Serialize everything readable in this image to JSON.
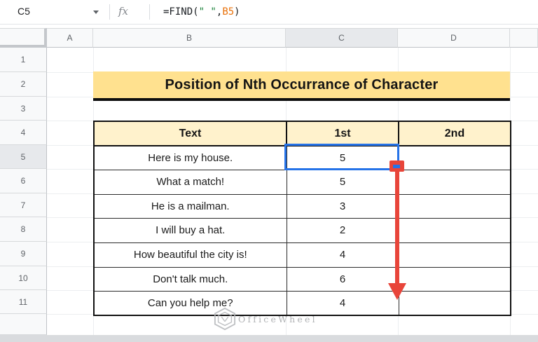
{
  "formula_bar": {
    "cell_reference": "C5",
    "fx_label": "fx",
    "formula_full": "=FIND(\" \",B5)",
    "formula_segments": [
      {
        "text": "=FIND(",
        "color": "#1b1f23"
      },
      {
        "text": "\" \"",
        "color": "#188038"
      },
      {
        "text": ",",
        "color": "#1b1f23"
      },
      {
        "text": "B5",
        "color": "#e8710a"
      },
      {
        "text": ")",
        "color": "#1b1f23"
      }
    ]
  },
  "grid": {
    "column_headers": [
      "A",
      "B",
      "C",
      "D",
      ""
    ],
    "row_headers": [
      "1",
      "2",
      "3",
      "4",
      "5",
      "6",
      "7",
      "8",
      "9",
      "10",
      "11",
      ""
    ],
    "selected_column": "C",
    "selected_row": "5"
  },
  "title_banner": {
    "text": "Position of Nth Occurrance of Character"
  },
  "table": {
    "headers": [
      "Text",
      "1st",
      "2nd"
    ],
    "rows": [
      {
        "text": "Here is my house.",
        "first": "5",
        "second": ""
      },
      {
        "text": "What a match!",
        "first": "5",
        "second": ""
      },
      {
        "text": "He is a mailman.",
        "first": "3",
        "second": ""
      },
      {
        "text": "I will buy a hat.",
        "first": "2",
        "second": ""
      },
      {
        "text": "How beautiful the city is!",
        "first": "4",
        "second": ""
      },
      {
        "text": "Don't talk much.",
        "first": "6",
        "second": ""
      },
      {
        "text": "Can you help me?",
        "first": "4",
        "second": ""
      }
    ]
  },
  "watermark": {
    "text": "OfficeWheel"
  },
  "colors": {
    "selection_blue": "#2673e8",
    "annotation_red": "#e8453a",
    "banner_yellow": "#ffe18f",
    "table_header_cream": "#fff2cc",
    "header_highlight": "#e7e9ec",
    "string_green": "#188038",
    "reference_orange": "#e8710a"
  }
}
